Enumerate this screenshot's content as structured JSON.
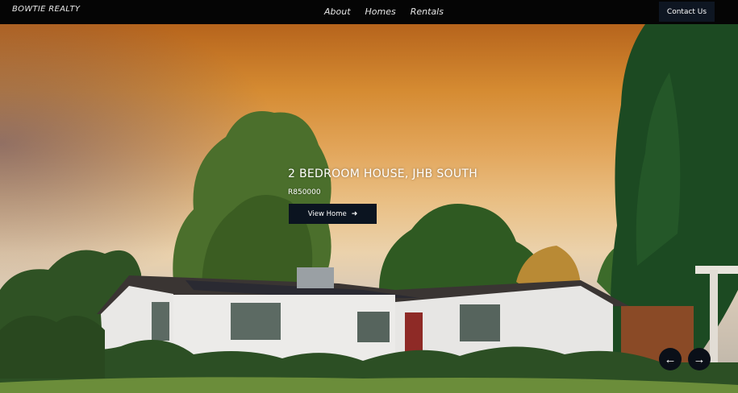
{
  "navbar": {
    "brand": "BOWTIE REALTY",
    "links": [
      {
        "label": "About"
      },
      {
        "label": "Homes"
      },
      {
        "label": "Rentals"
      }
    ],
    "contact_label": "Contact Us"
  },
  "hero": {
    "title": "2 BEDROOM HOUSE, JHB SOUTH",
    "price": "R850000",
    "cta_label": "View Home",
    "cta_icon": "arrow-right-icon",
    "prev_icon": "arrow-left-icon",
    "next_icon": "arrow-right-icon"
  }
}
